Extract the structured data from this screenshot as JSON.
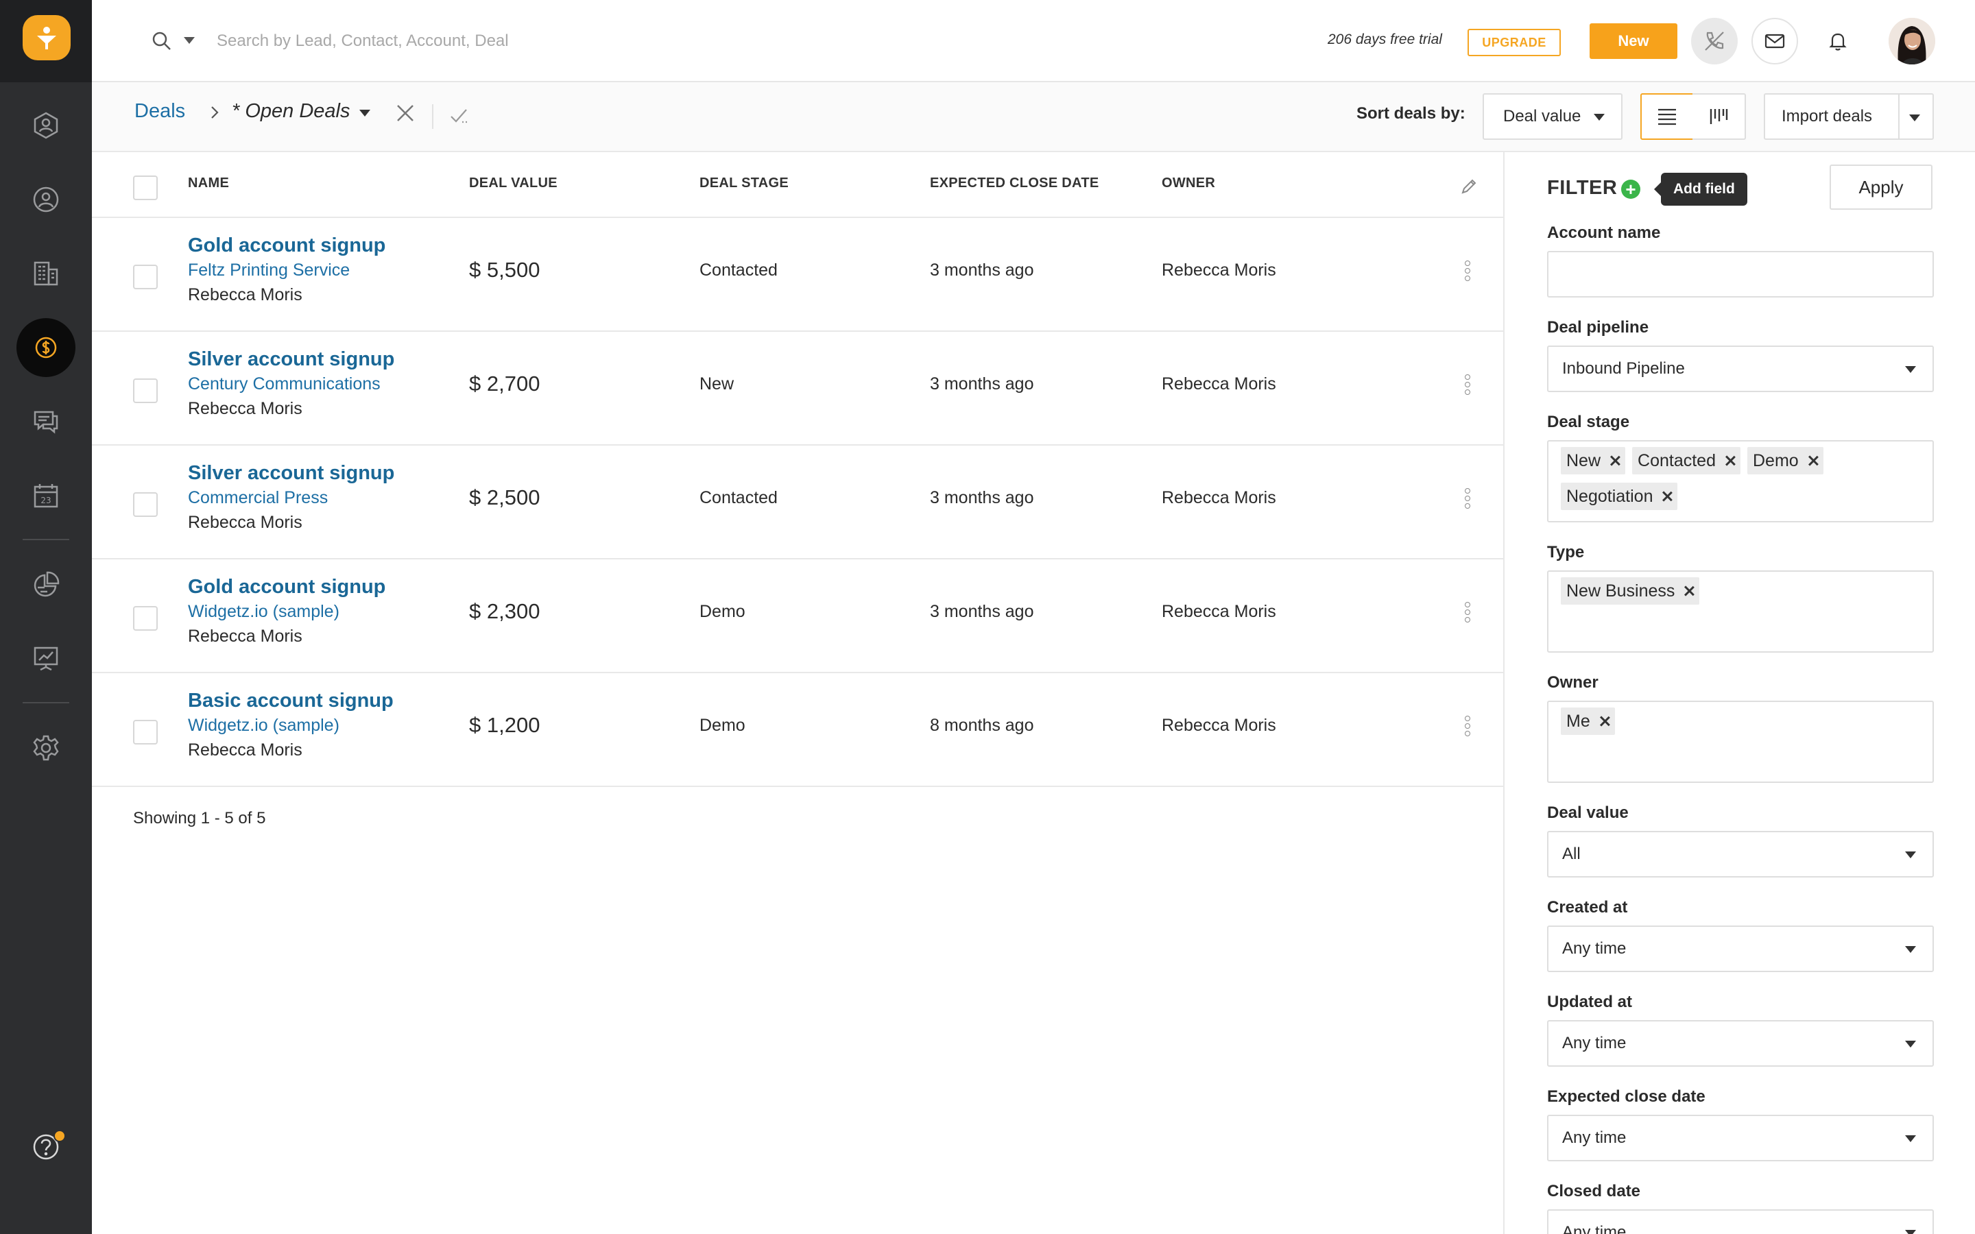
{
  "topbar": {
    "search_placeholder": "Search by Lead, Contact, Account, Deal",
    "trial_text": "206 days free trial",
    "upgrade_label": "UPGRADE",
    "new_label": "New"
  },
  "breadcrumb": {
    "root": "Deals",
    "view": "* Open Deals"
  },
  "sort": {
    "label": "Sort deals by:",
    "value": "Deal value"
  },
  "import_label": "Import deals",
  "table": {
    "columns": [
      "NAME",
      "DEAL VALUE",
      "DEAL STAGE",
      "EXPECTED CLOSE DATE",
      "OWNER"
    ],
    "rows": [
      {
        "name": "Gold account signup",
        "account": "Feltz Printing Service",
        "contact": "Rebecca Moris",
        "value": "$ 5,500",
        "stage": "Contacted",
        "close": "3 months ago",
        "owner": "Rebecca Moris"
      },
      {
        "name": "Silver account signup",
        "account": "Century Communications",
        "contact": "Rebecca Moris",
        "value": "$ 2,700",
        "stage": "New",
        "close": "3 months ago",
        "owner": "Rebecca Moris"
      },
      {
        "name": "Silver account signup",
        "account": "Commercial Press",
        "contact": "Rebecca Moris",
        "value": "$ 2,500",
        "stage": "Contacted",
        "close": "3 months ago",
        "owner": "Rebecca Moris"
      },
      {
        "name": "Gold account signup",
        "account": "Widgetz.io (sample)",
        "contact": "Rebecca Moris",
        "value": "$ 2,300",
        "stage": "Demo",
        "close": "3 months ago",
        "owner": "Rebecca Moris"
      },
      {
        "name": "Basic account signup",
        "account": "Widgetz.io (sample)",
        "contact": "Rebecca Moris",
        "value": "$ 1,200",
        "stage": "Demo",
        "close": "8 months ago",
        "owner": "Rebecca Moris"
      }
    ],
    "showing": "Showing 1 - 5 of 5"
  },
  "filter": {
    "title": "FILTER",
    "tooltip": "Add field",
    "apply_label": "Apply",
    "account_name_label": "Account name",
    "account_name_value": "",
    "pipeline_label": "Deal pipeline",
    "pipeline_value": "Inbound Pipeline",
    "stage_label": "Deal stage",
    "stage_tags": [
      "New",
      "Contacted",
      "Demo",
      "Negotiation"
    ],
    "type_label": "Type",
    "type_tags": [
      "New Business"
    ],
    "owner_label": "Owner",
    "owner_tags": [
      "Me"
    ],
    "deal_value_label": "Deal value",
    "deal_value_value": "All",
    "created_label": "Created at",
    "created_value": "Any time",
    "updated_label": "Updated at",
    "updated_value": "Any time",
    "expected_label": "Expected close date",
    "expected_value": "Any time",
    "closed_label": "Closed date",
    "closed_value": "Any time"
  },
  "colors": {
    "accent": "#f5a623",
    "link": "#1d6fa5",
    "sidebar": "#2d2e30",
    "add_green": "#3bb54a"
  },
  "icons": [
    "logo-icon",
    "search-icon",
    "contacts-icon",
    "user-icon",
    "accounts-icon",
    "deals-icon",
    "conversations-icon",
    "calendar-icon",
    "reports-icon",
    "analytics-icon",
    "settings-icon",
    "help-icon",
    "phone-icon",
    "mail-icon",
    "bell-icon",
    "list-view-icon",
    "board-view-icon",
    "pencil-icon",
    "close-icon",
    "check-icon",
    "add-field-icon"
  ]
}
